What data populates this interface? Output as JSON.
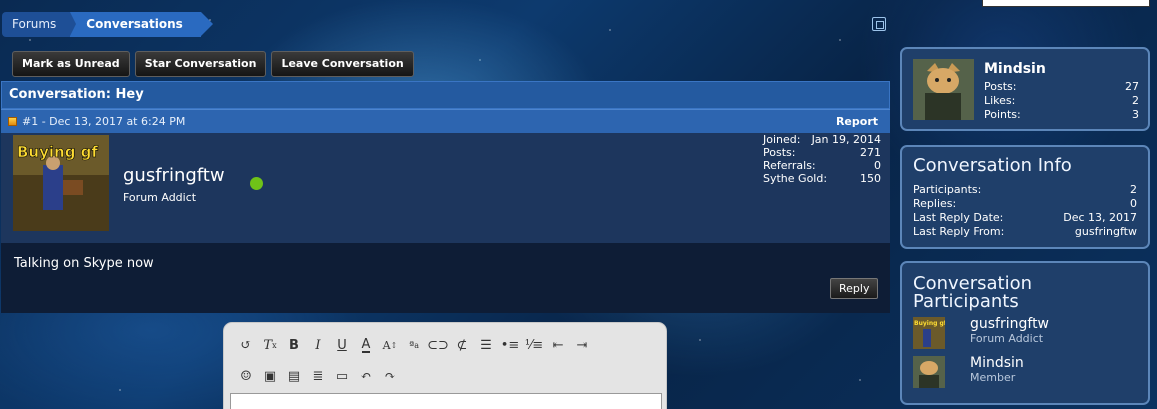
{
  "breadcrumb": {
    "forums": "Forums",
    "current": "Conversations"
  },
  "actions": {
    "mark_unread": "Mark as Unread",
    "star": "Star Conversation",
    "leave": "Leave Conversation"
  },
  "conversation": {
    "title": "Conversation: Hey",
    "message": {
      "permalink": "#1 - Dec 13, 2017 at 6:24 PM",
      "report": "Report",
      "author": "gusfringftw",
      "author_title": "Forum Addict",
      "avatar_caption": "Buying gf",
      "stats": [
        {
          "label": "Joined:",
          "value": "Jan 19, 2014"
        },
        {
          "label": "Posts:",
          "value": "271"
        },
        {
          "label": "Referrals:",
          "value": "0"
        },
        {
          "label": "Sythe Gold:",
          "value": "150"
        }
      ],
      "body": "Talking on Skype now",
      "reply": "Reply"
    }
  },
  "editor": {
    "row1": [
      "remove-format",
      "strikethrough",
      "B",
      "I",
      "U",
      "A",
      "A:",
      "a",
      "link",
      "unlink",
      "align",
      "bullets",
      "numbers",
      "outdent",
      "indent"
    ],
    "row2": [
      "smilie",
      "image",
      "media",
      "code",
      "save",
      "undo",
      "redo"
    ]
  },
  "sidebar": {
    "profile": {
      "name": "Mindsin",
      "stats": [
        {
          "label": "Posts:",
          "value": "27"
        },
        {
          "label": "Likes:",
          "value": "2"
        },
        {
          "label": "Points:",
          "value": "3"
        }
      ]
    },
    "info": {
      "title": "Conversation Info",
      "rows": [
        {
          "label": "Participants:",
          "value": "2"
        },
        {
          "label": "Replies:",
          "value": "0"
        },
        {
          "label": "Last Reply Date:",
          "value": "Dec 13, 2017"
        },
        {
          "label": "Last Reply From:",
          "value": "gusfringftw"
        }
      ]
    },
    "participants": {
      "title": "Conversation Participants",
      "list": [
        {
          "name": "gusfringftw",
          "title": "Forum Addict"
        },
        {
          "name": "Mindsin",
          "title": "Member"
        }
      ]
    }
  },
  "colors": {
    "online": "#6fc218",
    "accent": "#2a6ac0"
  }
}
